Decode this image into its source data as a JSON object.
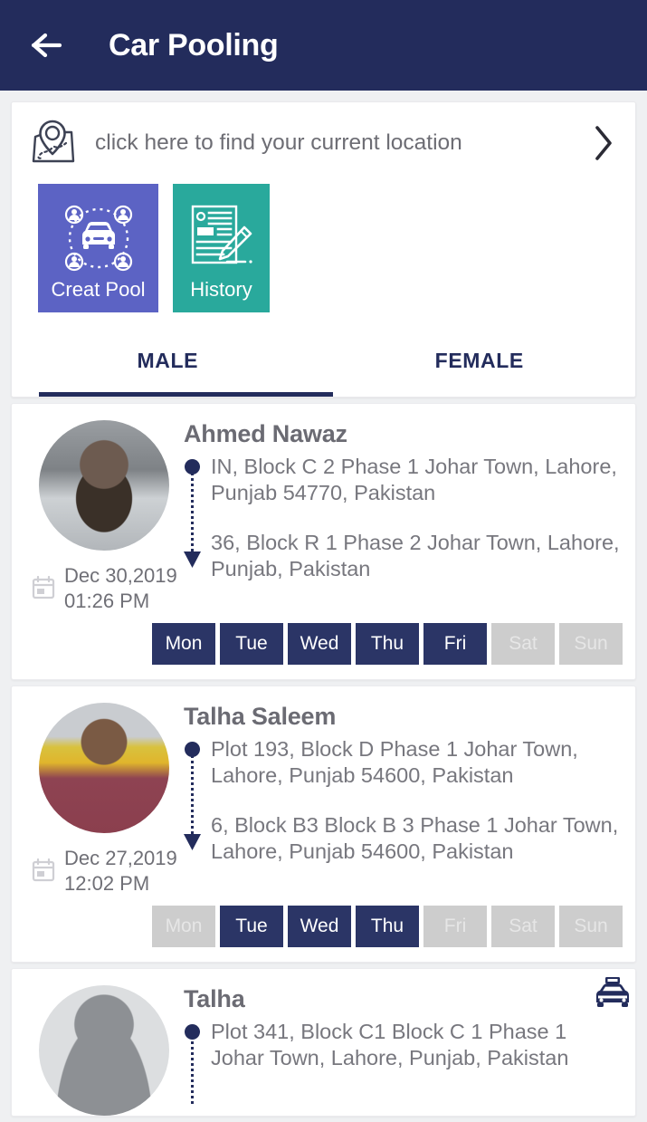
{
  "appbar": {
    "back_icon": "arrow-left-icon",
    "title": "Car Pooling",
    "bg_color": "#232c5c"
  },
  "locate": {
    "icon": "map-location-pin-icon",
    "label": "click here to find your current location",
    "chevron_icon": "chevron-right-icon"
  },
  "tiles": [
    {
      "label": "Creat Pool",
      "icon": "carpool-icon",
      "color": "#5c63c4"
    },
    {
      "label": "History",
      "icon": "document-edit-icon",
      "color": "#29a99c"
    }
  ],
  "tabs": {
    "items": [
      {
        "label": "MALE",
        "active": true
      },
      {
        "label": "FEMALE",
        "active": false
      }
    ],
    "indicator_color": "#232c5c"
  },
  "day_labels": [
    "Mon",
    "Tue",
    "Wed",
    "Thu",
    "Fri",
    "Sat",
    "Sun"
  ],
  "colors": {
    "day_on": "#2b3566",
    "day_off": "#cdcdcd",
    "page_bg": "#eff0f2",
    "card_bg": "#ffffff"
  },
  "pools": [
    {
      "name": "Ahmed Nawaz",
      "avatar": "photo-a",
      "badge_icon": null,
      "origin": "IN, Block C 2 Phase 1 Johar Town, Lahore, Punjab 54770, Pakistan",
      "destination": "36, Block R 1 Phase 2 Johar Town, Lahore, Punjab, Pakistan",
      "date": "Dec 30,2019",
      "time": "01:26 PM",
      "days_active": [
        true,
        true,
        true,
        true,
        true,
        false,
        false
      ]
    },
    {
      "name": "Talha Saleem",
      "avatar": "photo-b",
      "badge_icon": null,
      "origin": "Plot 193, Block D Phase 1 Johar Town, Lahore, Punjab 54600, Pakistan",
      "destination": "6, Block B3 Block B 3 Phase 1 Johar Town, Lahore, Punjab 54600, Pakistan",
      "date": "Dec 27,2019",
      "time": "12:02 PM",
      "days_active": [
        false,
        true,
        true,
        true,
        false,
        false,
        false
      ]
    },
    {
      "name": "Talha",
      "avatar": "photo-silhouette",
      "badge_icon": "taxi-icon",
      "origin": "Plot 341, Block C1 Block C 1 Phase 1 Johar Town, Lahore, Punjab, Pakistan",
      "destination": "",
      "date": "",
      "time": "",
      "days_active": []
    }
  ]
}
